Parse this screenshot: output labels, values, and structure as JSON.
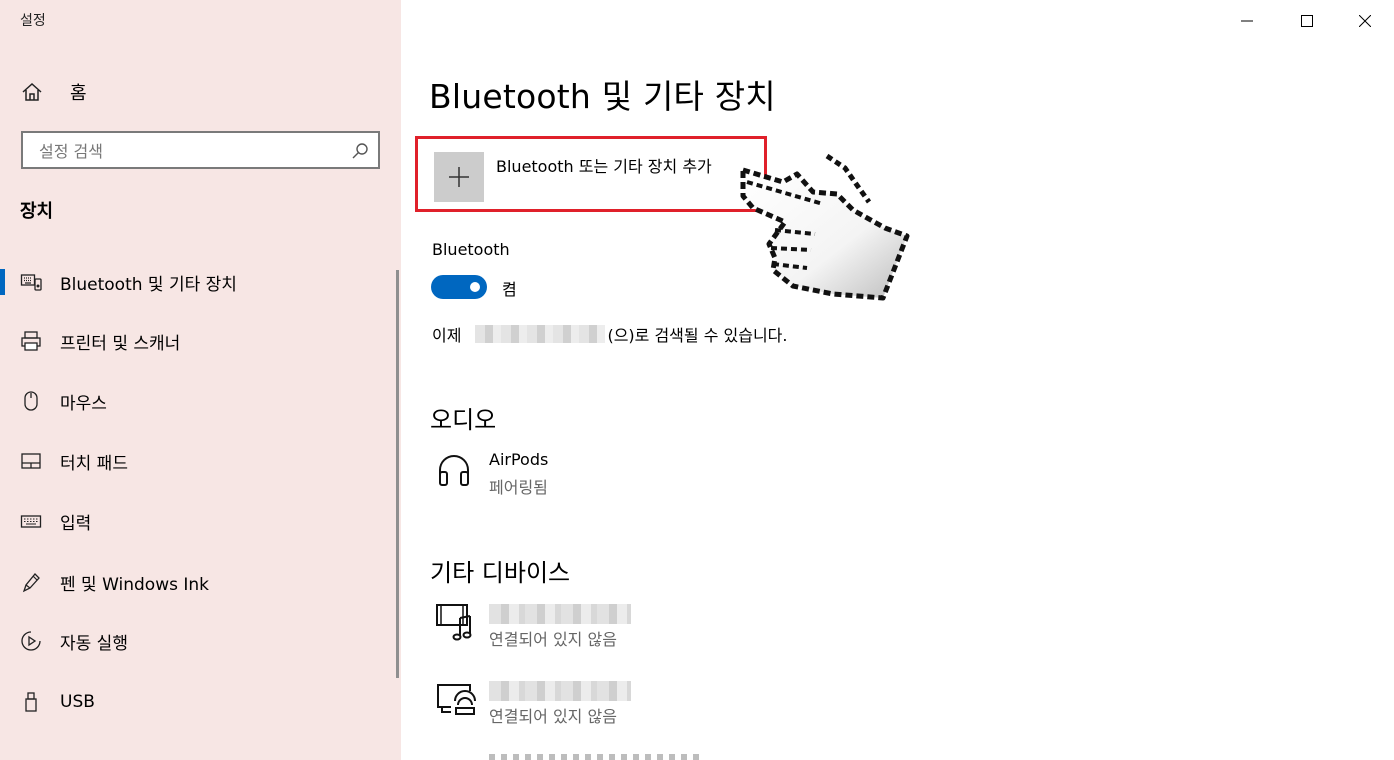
{
  "app": {
    "title": "설정"
  },
  "sidebar": {
    "home_label": "홈",
    "search_placeholder": "설정 검색",
    "section_title": "장치",
    "items": [
      {
        "label": "Bluetooth 및 기타 장치",
        "icon": "bluetooth-devices-icon",
        "active": true
      },
      {
        "label": "프린터 및 스캐너",
        "icon": "printer-icon"
      },
      {
        "label": "마우스",
        "icon": "mouse-icon"
      },
      {
        "label": "터치 패드",
        "icon": "touchpad-icon"
      },
      {
        "label": "입력",
        "icon": "keyboard-icon"
      },
      {
        "label": "펜 및 Windows Ink",
        "icon": "pen-icon"
      },
      {
        "label": "자동 실행",
        "icon": "autoplay-icon"
      },
      {
        "label": "USB",
        "icon": "usb-icon"
      }
    ]
  },
  "window_controls": {
    "minimize": "minimize-icon",
    "maximize": "maximize-icon",
    "close": "close-icon"
  },
  "main": {
    "title": "Bluetooth 및 기타 장치",
    "add_device_label": "Bluetooth 또는 기타 장치 추가",
    "bluetooth_label": "Bluetooth",
    "bluetooth_state": "켬",
    "discoverable_prefix": "이제",
    "discoverable_suffix": "(으)로 검색될 수 있습니다.",
    "audio_heading": "오디오",
    "audio_devices": [
      {
        "name": "AirPods",
        "status": "페어링됨",
        "icon": "headphones-icon"
      }
    ],
    "other_heading": "기타 디바이스",
    "other_devices": [
      {
        "status": "연결되어 있지 않음",
        "icon": "media-device-icon"
      },
      {
        "status": "연결되어 있지 않음",
        "icon": "wireless-display-icon"
      }
    ]
  },
  "colors": {
    "sidebar_bg": "#f7e6e4",
    "accent": "#0067c0",
    "highlight_border": "#e0202a"
  }
}
